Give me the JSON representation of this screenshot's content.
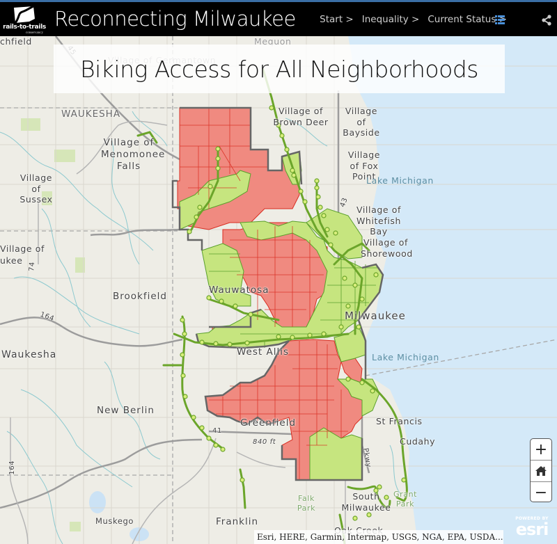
{
  "header": {
    "logo_text": "rails-to-trails",
    "logo_subtext": "conservancy",
    "app_title": "Reconnecting Milwaukee",
    "nav": [
      {
        "label": "Start >"
      },
      {
        "label": "Inequality >"
      },
      {
        "label": "Current Status >"
      }
    ],
    "icons": {
      "toc": "list-icon",
      "share": "share-icon"
    },
    "accent_color": "#4a90d9"
  },
  "map": {
    "title": "Biking Access for All Neighborhoods",
    "colors": {
      "no_access_fill": "#f08a80",
      "no_access_stroke": "#d92c20",
      "access_fill": "#c6e57f",
      "access_stroke": "#5aa02c",
      "trail": "#6ba52a",
      "trail_node": "#d8ee7c",
      "city_boundary": "#666666",
      "water": "#d4e9f8"
    },
    "place_labels": [
      {
        "text": "chfield",
        "kind": "town"
      },
      {
        "text": "Village of Germantown",
        "kind": "town"
      },
      {
        "text": "Mequon",
        "kind": "town"
      },
      {
        "text": "WAUKESHA",
        "kind": "county"
      },
      {
        "text": "Village of Menomonee Falls",
        "kind": "town"
      },
      {
        "text": "Village of Sussex",
        "kind": "town"
      },
      {
        "text": "Village of Brown Deer",
        "kind": "town"
      },
      {
        "text": "Village of Bayside",
        "kind": "town"
      },
      {
        "text": "Village of Fox Point",
        "kind": "town"
      },
      {
        "text": "Lake Michigan",
        "kind": "water"
      },
      {
        "text": "Village of Whitefish Bay",
        "kind": "town"
      },
      {
        "text": "Village of Shorewood",
        "kind": "town"
      },
      {
        "text": "Brookfield",
        "kind": "city"
      },
      {
        "text": "Wauwatosa",
        "kind": "city"
      },
      {
        "text": "Milwaukee",
        "kind": "city"
      },
      {
        "text": "Waukesha",
        "kind": "city"
      },
      {
        "text": "West Allis",
        "kind": "city"
      },
      {
        "text": "Lake Michigan",
        "kind": "water"
      },
      {
        "text": "New Berlin",
        "kind": "city"
      },
      {
        "text": "Greenfield",
        "kind": "city"
      },
      {
        "text": "St Francis",
        "kind": "town"
      },
      {
        "text": "Cudahy",
        "kind": "town"
      },
      {
        "text": "South Milwaukee",
        "kind": "town"
      },
      {
        "text": "Grant Park",
        "kind": "park"
      },
      {
        "text": "Falk Park",
        "kind": "park"
      },
      {
        "text": "Muskego",
        "kind": "town"
      },
      {
        "text": "Franklin",
        "kind": "city"
      },
      {
        "text": "Oak Creek",
        "kind": "city"
      },
      {
        "text": "ukee",
        "kind": "town"
      },
      {
        "text": "Village of",
        "kind": "town"
      }
    ],
    "road_labels": [
      "45",
      "43",
      "41",
      "164",
      "164",
      "74",
      "840 ft",
      "Pkwy"
    ],
    "zoom_controls": {
      "zoom_in": "+",
      "home": "home-icon",
      "zoom_out": "−"
    },
    "attribution": "Esri, HERE, Garmin, Intermap, USGS, NGA, EPA, USDA...",
    "powered_by": "POWERED BY",
    "esri": "esri"
  }
}
